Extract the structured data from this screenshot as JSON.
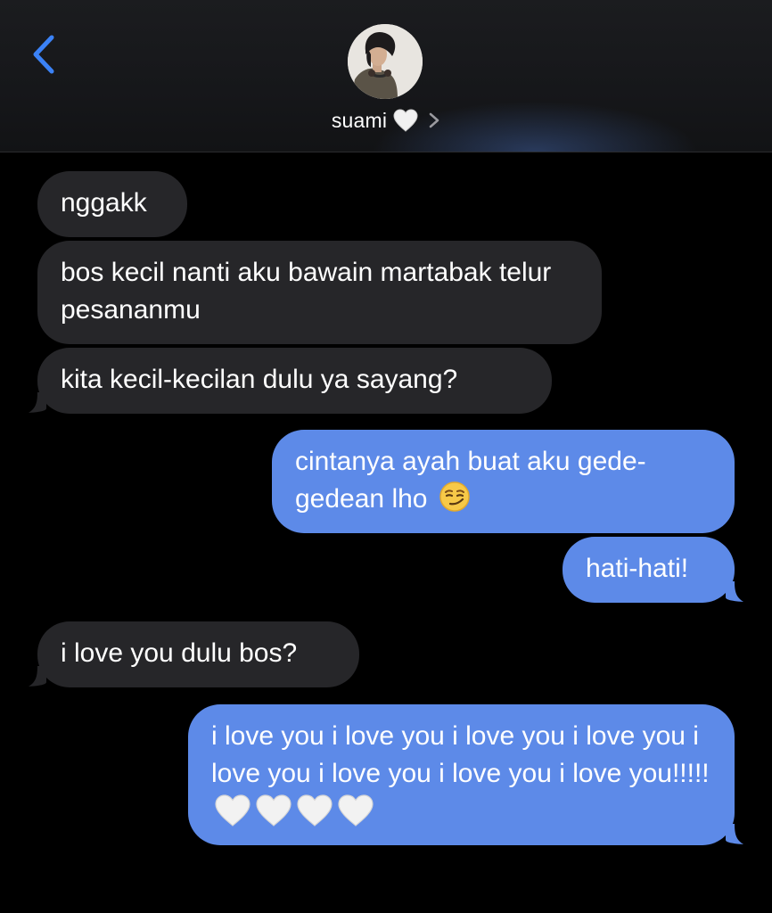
{
  "header": {
    "contact_name": "suami",
    "contact_emoji": "white-heart-icon",
    "back_icon": "chevron-left-icon",
    "disclosure_icon": "chevron-right-icon",
    "accent_color": "#3b82f6"
  },
  "messages": [
    {
      "direction": "incoming",
      "text": "nggakk"
    },
    {
      "direction": "incoming",
      "text": "bos kecil nanti aku bawain martabak telur pesananmu"
    },
    {
      "direction": "incoming",
      "text": "kita kecil-kecilan dulu ya sayang?"
    },
    {
      "direction": "outgoing",
      "text": "cintanya ayah buat aku gede-gedean lho",
      "emoji": "smirking-face-icon"
    },
    {
      "direction": "outgoing",
      "text": "hati-hati!"
    },
    {
      "direction": "incoming",
      "text": "i love you dulu bos?"
    },
    {
      "direction": "outgoing",
      "text": "i love you i love you i love you i love you i love you i love you i love you i love you!!!!!",
      "emoji": "white-heart-icon x4"
    }
  ],
  "colors": {
    "incoming_bubble": "#262629",
    "outgoing_bubble": "#5d8ae8",
    "background": "#000000"
  }
}
